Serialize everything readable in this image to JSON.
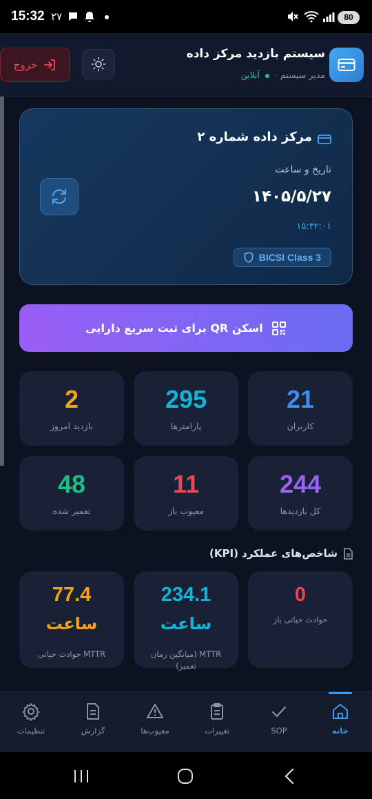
{
  "status_bar": {
    "time": "15:32",
    "day": "۲۷",
    "battery": "80",
    "icons": [
      "chat-bubble-icon",
      "bell-icon",
      "dot-icon",
      "mute-icon",
      "wifi-icon",
      "signal-icon"
    ]
  },
  "header": {
    "title": "سیستم بازدید مرکز داده",
    "role": "مدیر سیستم",
    "separator": "·",
    "status": "آنلاین",
    "logout_label": "خروج",
    "icons": [
      "credit-card-icon",
      "sun-icon",
      "logout-icon"
    ]
  },
  "datacenter_card": {
    "title": "مرکز داده شماره ۲",
    "datetime_label": "تاریخ و ساعت",
    "date": "۱۴۰۵/۵/۲۷",
    "time": "۱۵:۳۲:۰۱",
    "badge": "BICSI Class 3",
    "icons": [
      "server-card-icon",
      "shield-icon",
      "refresh-icon"
    ]
  },
  "qr_button": {
    "label": "اسکن QR برای ثبت سریع دارایی",
    "icon": "qr-code-icon"
  },
  "stats": [
    {
      "value": "21",
      "label": "کاربران",
      "color": "#3b8ff0"
    },
    {
      "value": "295",
      "label": "پارامترها",
      "color": "#13b4d6"
    },
    {
      "value": "2",
      "label": "بازدید امروز",
      "color": "#f5a21b"
    },
    {
      "value": "244",
      "label": "کل بازدیدها",
      "color": "#9a63f2"
    },
    {
      "value": "11",
      "label": "معیوب باز",
      "color": "#ef4452"
    },
    {
      "value": "48",
      "label": "تعمیر شده",
      "color": "#1dbf83"
    }
  ],
  "kpi": {
    "heading": "شاخص‌های عملکرد (KPI)",
    "items": [
      {
        "value": "0",
        "unit": "",
        "label": "حوادث حیاتی باز",
        "color": "#ef4452"
      },
      {
        "value": "234.1",
        "unit": "ساعت",
        "label": "MTTR (میانگین زمان تعمیر)",
        "color": "#13b4d6"
      },
      {
        "value": "77.4",
        "unit": "ساعت",
        "label": "MTTR حوادث حیاتی",
        "color": "#f5a21b"
      }
    ]
  },
  "bottom_nav": {
    "items": [
      {
        "label": "خانه",
        "icon": "home-icon",
        "active": true
      },
      {
        "label": "SOP",
        "icon": "check-icon",
        "active": false
      },
      {
        "label": "تغییرات",
        "icon": "clipboard-icon",
        "active": false
      },
      {
        "label": "معیوب‌ها",
        "icon": "warning-icon",
        "active": false
      },
      {
        "label": "گزارش",
        "icon": "document-icon",
        "active": false
      },
      {
        "label": "تنظیمات",
        "icon": "settings-icon",
        "active": false
      }
    ]
  },
  "colors": {
    "background": "#0c1220",
    "card": "#182136",
    "accent": "#3b9cf0",
    "danger": "#ef4452",
    "success": "#22c58b"
  }
}
